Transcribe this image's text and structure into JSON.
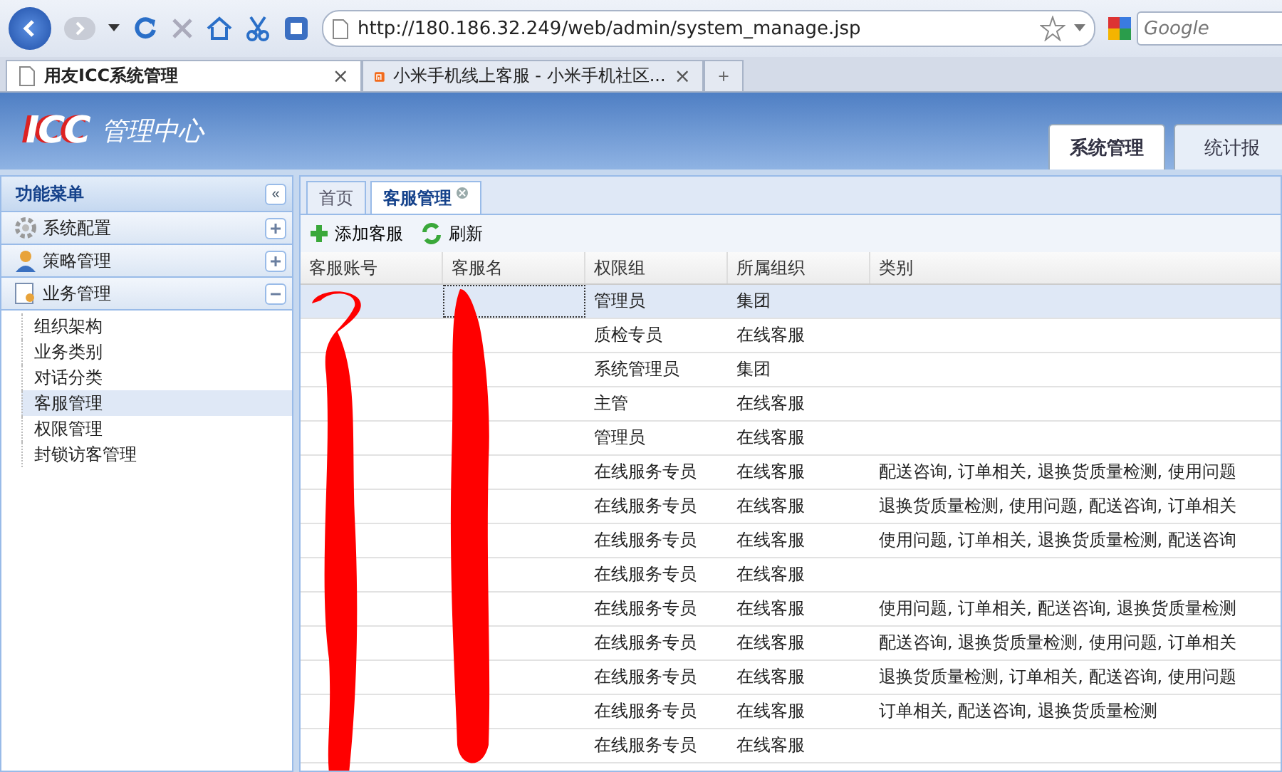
{
  "browser": {
    "url": "http://180.186.32.249/web/admin/system_manage.jsp",
    "search_placeholder": "Google",
    "tabs": [
      {
        "title": "用友ICC系统管理",
        "selected": true,
        "close": "×"
      },
      {
        "title": "小米手机线上客服 - 小米手机社区...",
        "selected": false,
        "close": "×"
      }
    ],
    "new_tab": "+"
  },
  "header": {
    "logo": "ICC",
    "title": "管理中心",
    "tabs": [
      {
        "label": "系统管理",
        "selected": true
      },
      {
        "label": "统计报",
        "selected": false
      }
    ]
  },
  "sidebar": {
    "title": "功能菜单",
    "collapse": "«",
    "sections": [
      {
        "label": "系统配置",
        "expanded": false
      },
      {
        "label": "策略管理",
        "expanded": false
      },
      {
        "label": "业务管理",
        "expanded": true,
        "items": [
          {
            "label": "组织架构",
            "selected": false
          },
          {
            "label": "业务类别",
            "selected": false
          },
          {
            "label": "对话分类",
            "selected": false
          },
          {
            "label": "客服管理",
            "selected": true
          },
          {
            "label": "权限管理",
            "selected": false
          },
          {
            "label": "封锁访客管理",
            "selected": false
          }
        ]
      }
    ]
  },
  "content_tabs": [
    {
      "label": "首页",
      "selected": false,
      "closable": false
    },
    {
      "label": "客服管理",
      "selected": true,
      "closable": true
    }
  ],
  "toolbar": [
    {
      "label": "添加客服"
    },
    {
      "label": "刷新"
    }
  ],
  "table": {
    "columns": [
      "客服账号",
      "客服名",
      "权限组",
      "所属组织",
      "类别"
    ],
    "rows": [
      {
        "selected": true,
        "role": "管理员",
        "org": "集团",
        "category": ""
      },
      {
        "selected": false,
        "role": "质检专员",
        "org": "在线客服",
        "category": ""
      },
      {
        "selected": false,
        "role": "系统管理员",
        "org": "集团",
        "category": ""
      },
      {
        "selected": false,
        "role": "主管",
        "org": "在线客服",
        "category": ""
      },
      {
        "selected": false,
        "role": "管理员",
        "org": "在线客服",
        "category": ""
      },
      {
        "selected": false,
        "role": "在线服务专员",
        "org": "在线客服",
        "category": "配送咨询, 订单相关, 退换货质量检测, 使用问题"
      },
      {
        "selected": false,
        "role": "在线服务专员",
        "org": "在线客服",
        "category": "退换货质量检测, 使用问题, 配送咨询, 订单相关"
      },
      {
        "selected": false,
        "role": "在线服务专员",
        "org": "在线客服",
        "category": "使用问题, 订单相关, 退换货质量检测, 配送咨询"
      },
      {
        "selected": false,
        "role": "在线服务专员",
        "org": "在线客服",
        "category": ""
      },
      {
        "selected": false,
        "role": "在线服务专员",
        "org": "在线客服",
        "category": "使用问题, 订单相关, 配送咨询, 退换货质量检测"
      },
      {
        "selected": false,
        "role": "在线服务专员",
        "org": "在线客服",
        "category": "配送咨询, 退换货质量检测, 使用问题, 订单相关"
      },
      {
        "selected": false,
        "role": "在线服务专员",
        "org": "在线客服",
        "category": "退换货质量检测, 订单相关, 配送咨询, 使用问题"
      },
      {
        "selected": false,
        "role": "在线服务专员",
        "org": "在线客服",
        "category": "订单相关, 配送咨询, 退换货质量检测"
      },
      {
        "selected": false,
        "role": "在线服务专员",
        "org": "在线客服",
        "category": ""
      }
    ]
  }
}
